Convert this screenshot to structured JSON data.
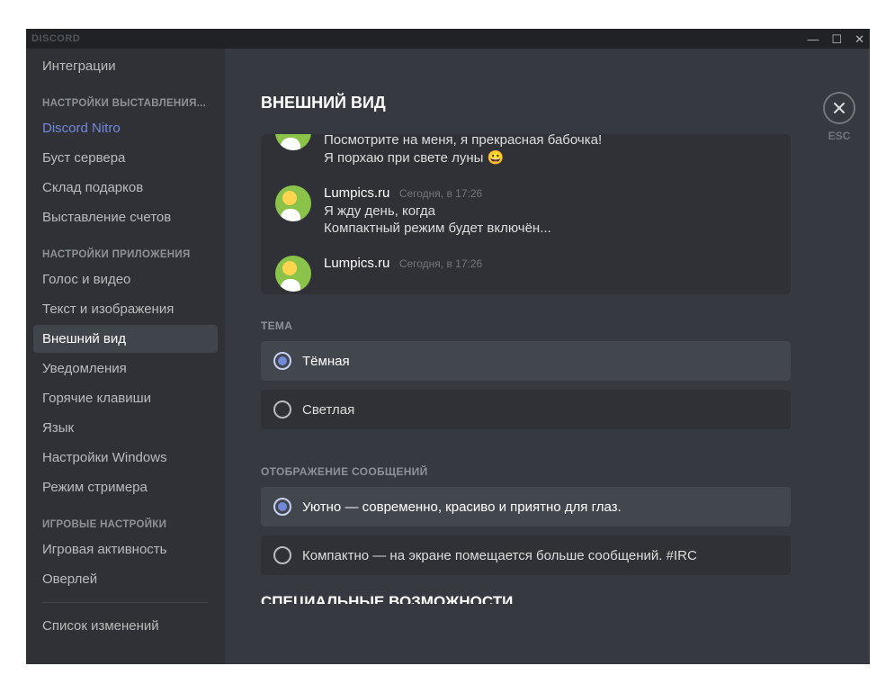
{
  "titlebar": {
    "brand": "DISCORD"
  },
  "close": {
    "esc": "ESC"
  },
  "sidebar": {
    "top_item": "Интеграции",
    "section_billing": "НАСТРОЙКИ ВЫСТАВЛЕНИЯ...",
    "billing_items": [
      "Discord Nitro",
      "Буст сервера",
      "Склад подарков",
      "Выставление счетов"
    ],
    "section_app": "НАСТРОЙКИ ПРИЛОЖЕНИЯ",
    "app_items": [
      "Голос и видео",
      "Текст и изображения",
      "Внешний вид",
      "Уведомления",
      "Горячие клавиши",
      "Язык",
      "Настройки Windows",
      "Режим стримера"
    ],
    "section_game": "ИГРОВЫЕ НАСТРОЙКИ",
    "game_items": [
      "Игровая активность",
      "Оверлей"
    ],
    "changelog": "Список изменений"
  },
  "page": {
    "title": "ВНЕШНИЙ ВИД",
    "preview": {
      "msg0_line1": "Посмотрите на меня, я прекрасная бабочка!",
      "msg0_line2": "Я порхаю при свете луны 😀",
      "msg1_user": "Lumpics.ru",
      "msg1_ts": "Сегодня, в 17:26",
      "msg1_line1": "Я жду день, когда",
      "msg1_line2": "Компактный режим будет включён...",
      "msg2_user": "Lumpics.ru",
      "msg2_ts": "Сегодня, в 17:26"
    },
    "theme": {
      "label": "ТЕМА",
      "dark": "Тёмная",
      "light": "Светлая"
    },
    "display": {
      "label": "ОТОБРАЖЕНИЕ СООБЩЕНИЙ",
      "cozy": "Уютно — современно, красиво и приятно для глаз.",
      "compact": "Компактно — на экране помещается больше сообщений. #IRC"
    },
    "accessibility_cutoff": "СПЕЦИАЛЬНЫЕ ВОЗМОЖНОСТИ"
  }
}
